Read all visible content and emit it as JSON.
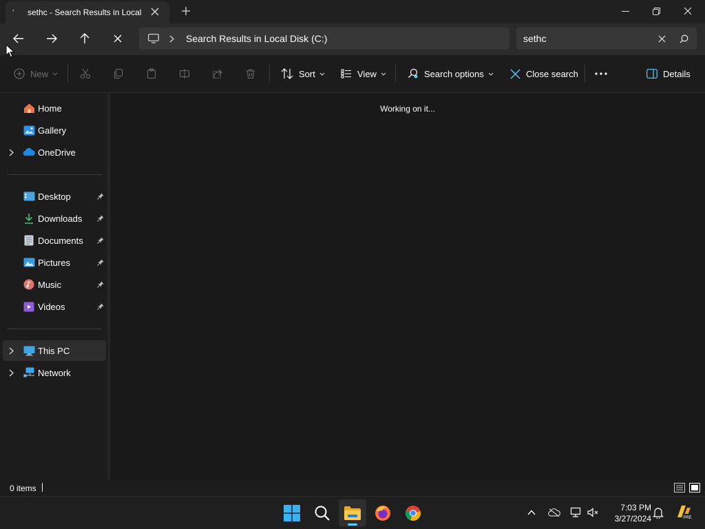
{
  "tab": {
    "title": "sethc - Search Results in Local",
    "close_label": "Close tab",
    "new_tab_label": "New tab"
  },
  "window_controls": [
    "minimize",
    "restore",
    "close"
  ],
  "navigation": {
    "address_root_icon": "this-pc-icon",
    "address_location": "Search Results in Local Disk (C:)",
    "search_value": "sethc"
  },
  "commands": {
    "new_label": "New",
    "sort_label": "Sort",
    "view_label": "View",
    "search_options_label": "Search options",
    "close_search_label": "Close search",
    "more_label": "···",
    "details_label": "Details"
  },
  "sidebar": {
    "top": [
      {
        "label": "Home",
        "icon": "home-icon",
        "expandable": false
      },
      {
        "label": "Gallery",
        "icon": "gallery-icon",
        "expandable": false
      },
      {
        "label": "OneDrive",
        "icon": "onedrive-icon",
        "expandable": true
      }
    ],
    "quick_access": [
      {
        "label": "Desktop",
        "icon": "desktop-icon",
        "pinned": true
      },
      {
        "label": "Downloads",
        "icon": "downloads-icon",
        "pinned": true
      },
      {
        "label": "Documents",
        "icon": "documents-icon",
        "pinned": true
      },
      {
        "label": "Pictures",
        "icon": "pictures-icon",
        "pinned": true
      },
      {
        "label": "Music",
        "icon": "music-icon",
        "pinned": true
      },
      {
        "label": "Videos",
        "icon": "videos-icon",
        "pinned": true
      }
    ],
    "bottom": [
      {
        "label": "This PC",
        "icon": "this-pc-icon",
        "expandable": true,
        "selected": true
      },
      {
        "label": "Network",
        "icon": "network-icon",
        "expandable": true,
        "selected": false
      }
    ]
  },
  "content": {
    "status_message": "Working on it..."
  },
  "statusbar": {
    "item_count": "0 items"
  },
  "taskbar": {
    "apps": [
      "start-icon",
      "search-icon",
      "file-explorer-icon",
      "firefox-icon",
      "chrome-icon"
    ],
    "active_app": "file-explorer-icon",
    "time": "7:03 PM",
    "date": "3/27/2024"
  },
  "colors": {
    "accent": "#60cdff",
    "window_bg": "#191919",
    "chrome_bg": "#2b2b2b",
    "folder_yellow": "#f4c542"
  }
}
